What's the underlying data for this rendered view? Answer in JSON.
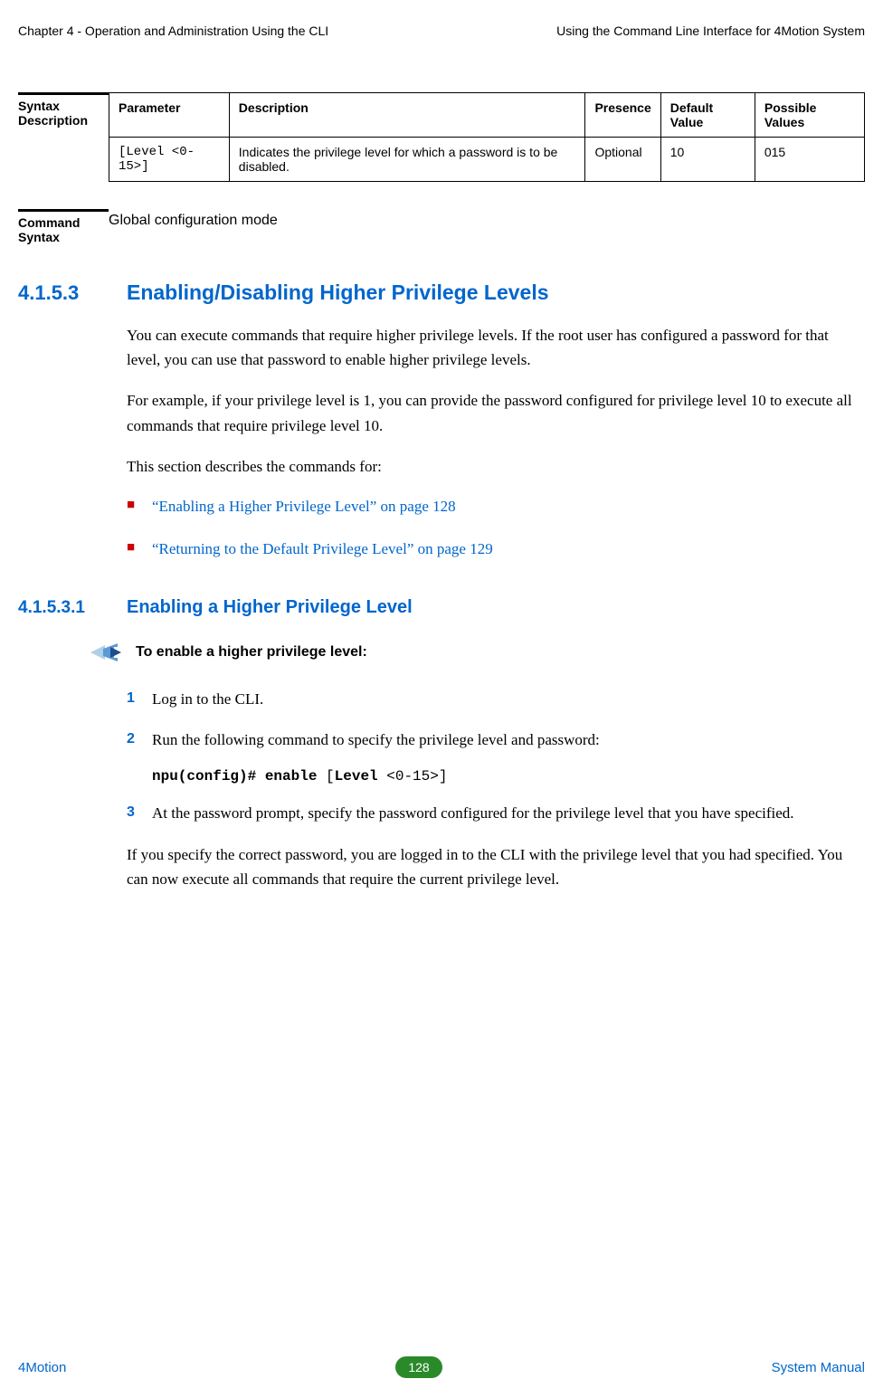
{
  "header": {
    "left": "Chapter 4 - Operation and Administration Using the CLI",
    "right": "Using the Command Line Interface for 4Motion System"
  },
  "syntax_description": {
    "label": "Syntax Description",
    "columns": [
      "Parameter",
      "Description",
      "Presence",
      "Default Value",
      "Possible Values"
    ],
    "rows": [
      {
        "parameter": "[Level <0-15>]",
        "description": "Indicates the privilege level for which a password is to be disabled.",
        "presence": "Optional",
        "default": "10",
        "possible": "015"
      }
    ]
  },
  "command_syntax": {
    "label": "Command Syntax",
    "mode": "Global configuration mode"
  },
  "section1": {
    "num": "4.1.5.3",
    "title": "Enabling/Disabling Higher Privilege Levels",
    "p1": "You can execute commands that require higher privilege levels. If the root user has configured a password for that level, you can use that password to enable higher privilege levels.",
    "p2": "For example, if your privilege level is 1, you can provide the password configured for privilege level 10 to execute all commands that require privilege level 10.",
    "p3": "This section describes the commands for:",
    "bullets": [
      "“Enabling a Higher Privilege Level” on page 128",
      "“Returning to the Default Privilege Level” on page 129"
    ]
  },
  "section2": {
    "num": "4.1.5.3.1",
    "title": "Enabling a Higher Privilege Level",
    "procedure_title": "To enable a higher privilege level:",
    "steps": [
      "Log in to the CLI.",
      "Run the following command to specify the privilege level and password:",
      "At the password prompt, specify the password configured for the privilege level that you have specified."
    ],
    "cmd_bold1": "npu(config)# enable ",
    "cmd_plain1": "[",
    "cmd_bold2": "Level ",
    "cmd_plain2": "<0-15>]",
    "closing": "If you specify the correct password, you are logged in to the CLI with the privilege level that you had specified. You can now execute all commands that require the current privilege level."
  },
  "footer": {
    "left": "4Motion",
    "page": "128",
    "right": "System Manual"
  }
}
